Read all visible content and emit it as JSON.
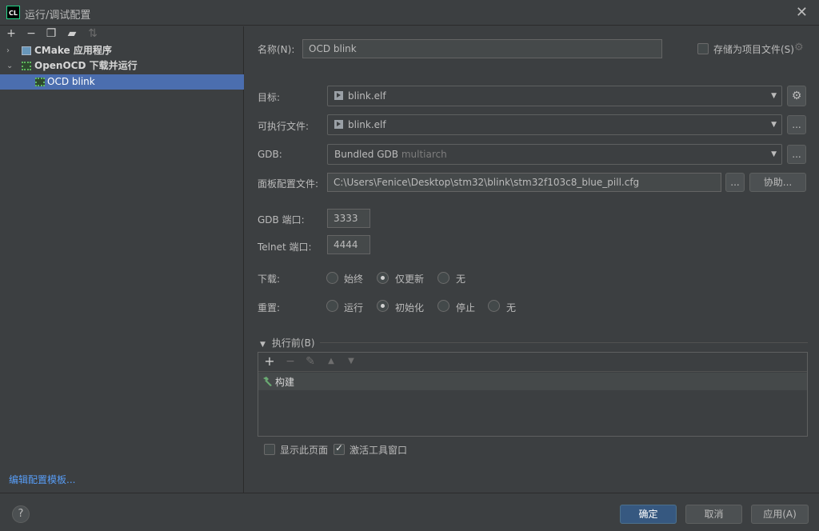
{
  "window": {
    "logo": "CL",
    "title": "运行/调试配置"
  },
  "toolbar": {
    "icons": [
      "add-icon",
      "remove-icon",
      "copy-icon",
      "folder-icon",
      "sort-icon"
    ]
  },
  "tree": [
    {
      "label": "CMake 应用程序",
      "icon": "cmake-icon",
      "expanded": false
    },
    {
      "label": "OpenOCD 下载并运行",
      "icon": "chip-icon",
      "expanded": true
    },
    {
      "label": "OCD blink",
      "icon": "chip-icon",
      "selected": true
    }
  ],
  "edit_templates": "编辑配置模板...",
  "form": {
    "name_label": "名称(N):",
    "name_value": "OCD blink",
    "store_as_file": "存储为项目文件(S)",
    "target_label": "目标:",
    "target_value": "blink.elf",
    "exe_label": "可执行文件:",
    "exe_value": "blink.elf",
    "gdb_label": "GDB:",
    "gdb_value": "Bundled GDB",
    "gdb_hint": "multiarch",
    "board_label": "面板配置文件:",
    "board_value": "C:\\Users\\Fenice\\Desktop\\stm32\\blink\\stm32f103c8_blue_pill.cfg",
    "board_browse": "...",
    "assist_label": "协助...",
    "more_label": "...",
    "gdb_port_label": "GDB 端口:",
    "gdb_port": "3333",
    "telnet_port_label": "Telnet 端口:",
    "telnet_port": "4444",
    "download_label": "下载:",
    "download_options": [
      "始终",
      "仅更新",
      "无"
    ],
    "download_selected": "仅更新",
    "reset_label": "重置:",
    "reset_options": [
      "运行",
      "初始化",
      "停止",
      "无"
    ],
    "reset_selected": "初始化"
  },
  "before_launch": {
    "title": "执行前(B)",
    "tools": [
      "add-icon",
      "remove-icon",
      "edit-icon",
      "move-up-icon",
      "move-down-icon"
    ],
    "items": [
      "构建"
    ],
    "show_page": "显示此页面",
    "activate_tool_window": "激活工具窗口",
    "show_page_checked": false,
    "activate_checked": true
  },
  "footer": {
    "help": "?",
    "ok": "确定",
    "cancel": "取消",
    "apply": "应用(A)"
  }
}
